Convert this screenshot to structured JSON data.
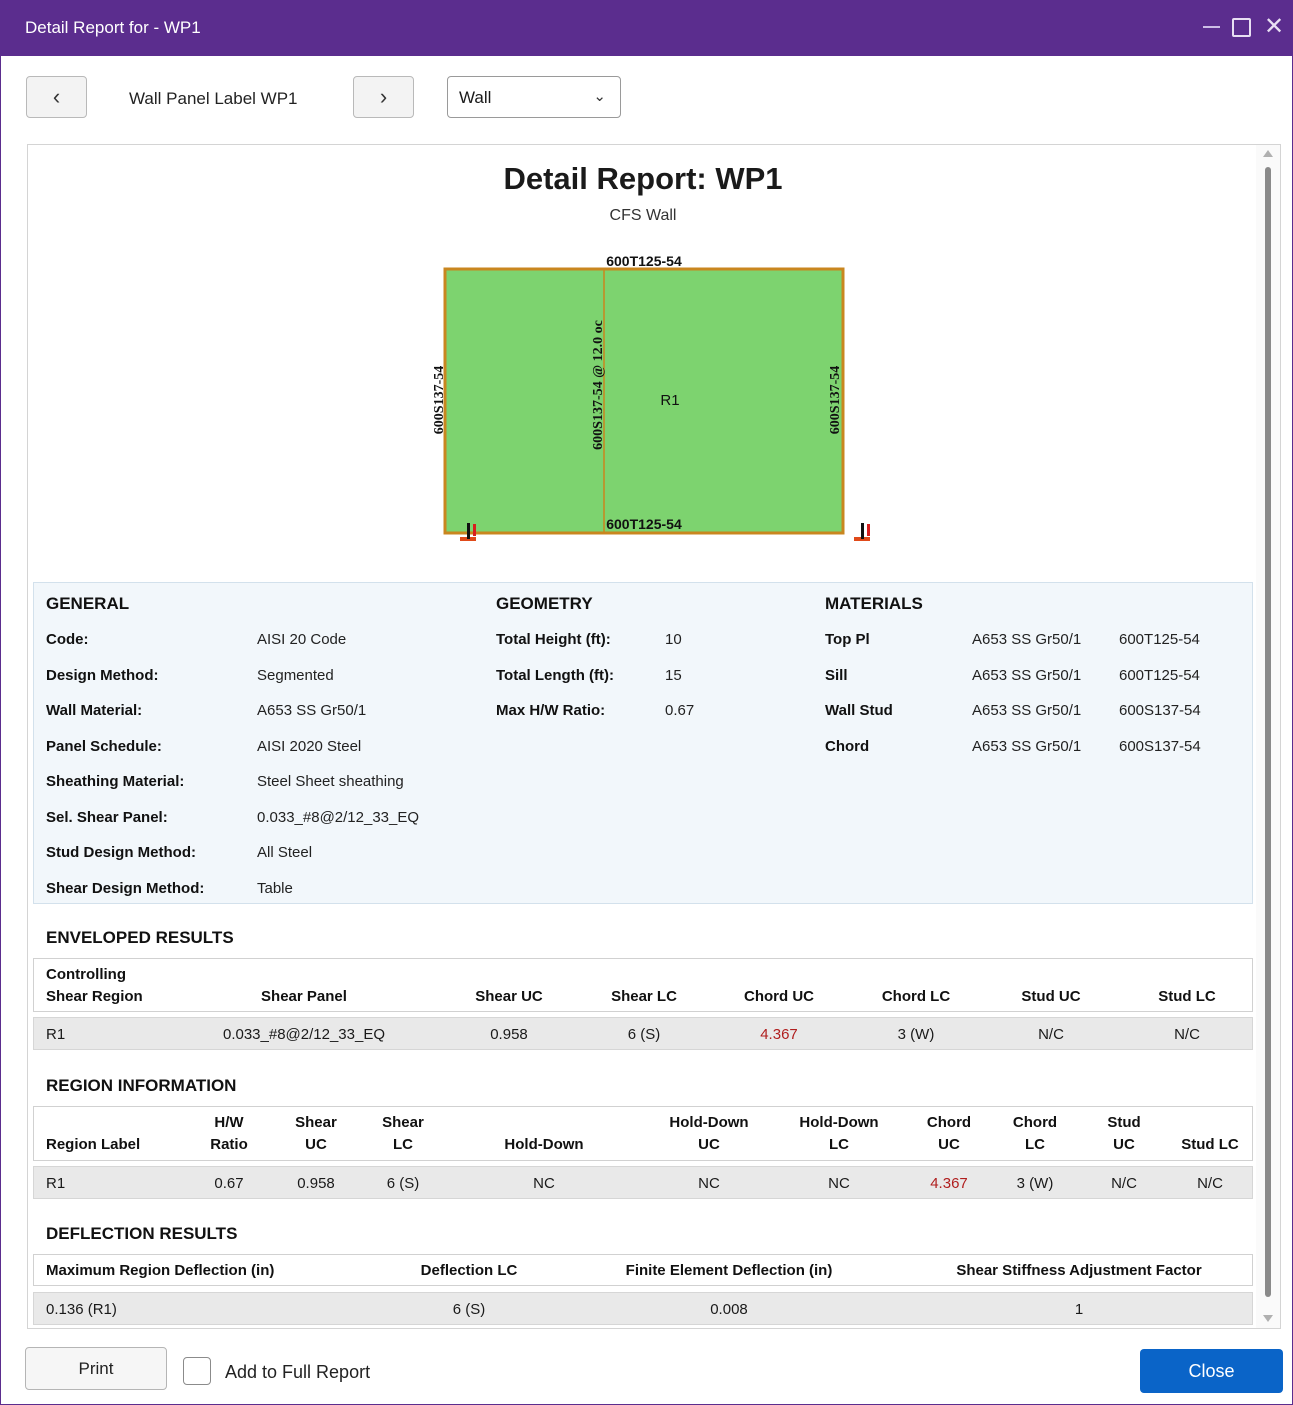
{
  "window": {
    "title": "Detail Report for - WP1"
  },
  "toolbar": {
    "panel_label": "Wall Panel Label WP1",
    "type_value": "Wall"
  },
  "report": {
    "title": "Detail Report: WP1",
    "subtitle": "CFS Wall",
    "diagram": {
      "top_label": "600T125-54",
      "bottom_label": "600T125-54",
      "left_label": "600S137-54",
      "right_label": "600S137-54",
      "stud_label": "600S137-54 @ 12.0 oc",
      "region_label": "R1",
      "panel_color": "#7dd36f"
    },
    "general": {
      "heading": "GENERAL",
      "rows": [
        {
          "key": "Code:",
          "value": "AISI 20 Code"
        },
        {
          "key": "Design Method:",
          "value": "Segmented"
        },
        {
          "key": "Wall Material:",
          "value": "A653 SS Gr50/1"
        },
        {
          "key": "Panel Schedule:",
          "value": "AISI 2020 Steel"
        },
        {
          "key": "Sheathing Material:",
          "value": "Steel Sheet sheathing"
        },
        {
          "key": "Sel. Shear Panel:",
          "value": "0.033_#8@2/12_33_EQ"
        },
        {
          "key": "Stud Design Method:",
          "value": "All Steel"
        },
        {
          "key": "Shear Design Method:",
          "value": "Table"
        }
      ]
    },
    "geometry": {
      "heading": "GEOMETRY",
      "rows": [
        {
          "key": "Total Height (ft):",
          "value": "10"
        },
        {
          "key": "Total Length (ft):",
          "value": "15"
        },
        {
          "key": "Max H/W Ratio:",
          "value": "0.67"
        }
      ]
    },
    "materials": {
      "heading": "MATERIALS",
      "rows": [
        {
          "key": "Top Pl",
          "grade": "A653 SS Gr50/1",
          "section": "600T125-54"
        },
        {
          "key": "Sill",
          "grade": "A653 SS Gr50/1",
          "section": "600T125-54"
        },
        {
          "key": "Wall Stud",
          "grade": "A653 SS Gr50/1",
          "section": "600S137-54"
        },
        {
          "key": "Chord",
          "grade": "A653 SS Gr50/1",
          "section": "600S137-54"
        }
      ]
    },
    "enveloped": {
      "heading": "ENVELOPED RESULTS",
      "headers": [
        "Controlling\nShear Region",
        "Shear Panel",
        "Shear UC",
        "Shear LC",
        "Chord UC",
        "Chord LC",
        "Stud UC",
        "Stud LC"
      ],
      "row": [
        "R1",
        "0.033_#8@2/12_33_EQ",
        "0.958",
        "6 (S)",
        "4.367",
        "3 (W)",
        "N/C",
        "N/C"
      ]
    },
    "region": {
      "heading": "REGION INFORMATION",
      "headers": [
        "Region Label",
        "H/W\nRatio",
        "Shear\nUC",
        "Shear\nLC",
        "Hold-Down",
        "Hold-Down\nUC",
        "Hold-Down\nLC",
        "Chord\nUC",
        "Chord\nLC",
        "Stud\nUC",
        "Stud LC"
      ],
      "row": [
        "R1",
        "0.67",
        "0.958",
        "6 (S)",
        "NC",
        "NC",
        "NC",
        "4.367",
        "3 (W)",
        "N/C",
        "N/C"
      ]
    },
    "deflection": {
      "heading": "DEFLECTION RESULTS",
      "headers": [
        "Maximum Region Deflection (in)",
        "Deflection LC",
        "Finite Element Deflection (in)",
        "Shear Stiffness Adjustment Factor"
      ],
      "row": [
        "0.136 (R1)",
        "6 (S)",
        "0.008",
        "1"
      ]
    }
  },
  "footer": {
    "print_label": "Print",
    "checkbox_label": "Add to Full Report",
    "close_label": "Close"
  },
  "colors": {
    "accent": "#5b2d8e",
    "primary_button": "#0a64c8",
    "failing_value": "#b01e1e"
  }
}
